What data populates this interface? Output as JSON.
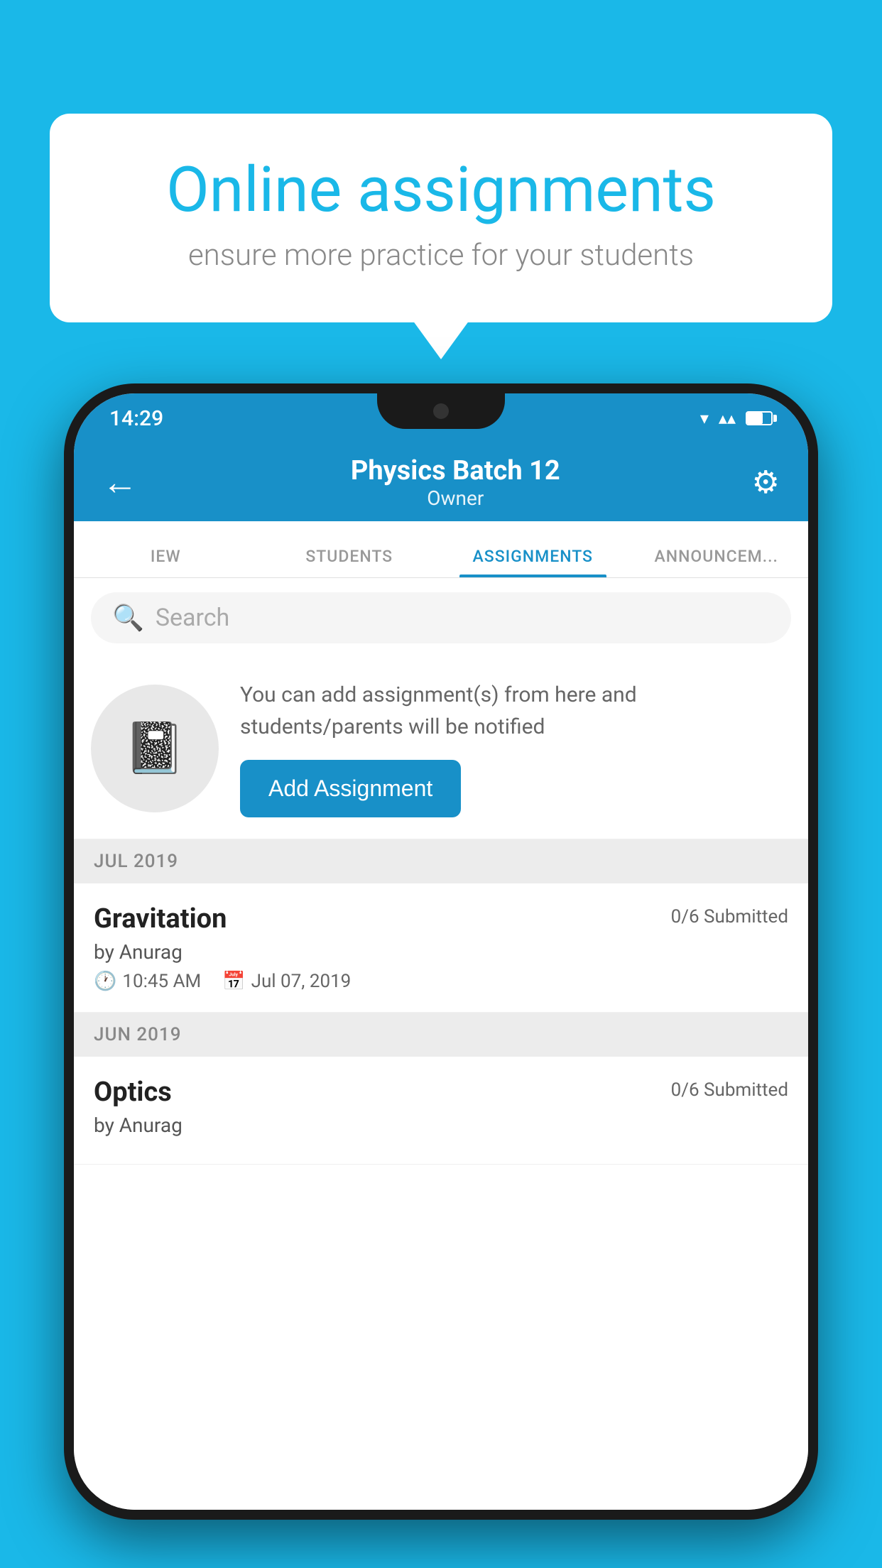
{
  "background_color": "#1ab8e8",
  "speech_bubble": {
    "title": "Online assignments",
    "subtitle": "ensure more practice for your students"
  },
  "status_bar": {
    "time": "14:29"
  },
  "app_bar": {
    "title": "Physics Batch 12",
    "subtitle": "Owner",
    "back_label": "←",
    "settings_label": "⚙"
  },
  "tabs": [
    {
      "label": "IEW",
      "active": false
    },
    {
      "label": "STUDENTS",
      "active": false
    },
    {
      "label": "ASSIGNMENTS",
      "active": true
    },
    {
      "label": "ANNOUNCEM...",
      "active": false
    }
  ],
  "search": {
    "placeholder": "Search"
  },
  "add_assignment_card": {
    "description": "You can add assignment(s) from here and students/parents will be notified",
    "button_label": "Add Assignment"
  },
  "months": [
    {
      "label": "JUL 2019",
      "assignments": [
        {
          "name": "Gravitation",
          "submitted": "0/6 Submitted",
          "by": "by Anurag",
          "time": "10:45 AM",
          "date": "Jul 07, 2019"
        }
      ]
    },
    {
      "label": "JUN 2019",
      "assignments": [
        {
          "name": "Optics",
          "submitted": "0/6 Submitted",
          "by": "by Anurag",
          "time": "",
          "date": ""
        }
      ]
    }
  ]
}
